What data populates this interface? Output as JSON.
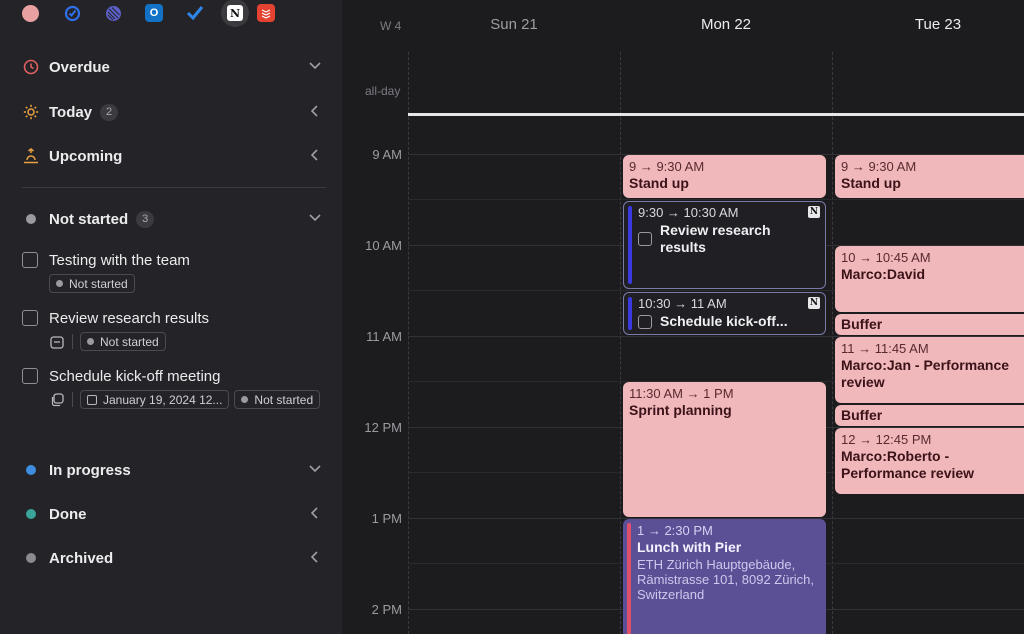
{
  "app_icons": [
    {
      "name": "avatar-icon",
      "color": "#e8a0a0"
    },
    {
      "name": "check-circle-icon",
      "color": "#2f6fed"
    },
    {
      "name": "linear-icon",
      "color": "#5b5fc7"
    },
    {
      "name": "outlook-icon",
      "color": "#1273c6"
    },
    {
      "name": "checkmark-icon",
      "color": "#2e86e8"
    },
    {
      "name": "notion-icon",
      "color": "#ffffff"
    },
    {
      "name": "todoist-icon",
      "color": "#e44332"
    }
  ],
  "sidebar": {
    "groups": [
      {
        "label": "Overdue",
        "count": "",
        "chevron": "⌄"
      },
      {
        "label": "Today",
        "count": "2",
        "chevron": "‹"
      },
      {
        "label": "Upcoming",
        "count": "",
        "chevron": "‹"
      },
      {
        "label": "Not started",
        "count": "3",
        "chevron": "⌄"
      },
      {
        "label": "In progress",
        "count": "",
        "chevron": "⌄"
      },
      {
        "label": "Done",
        "count": "",
        "chevron": "‹"
      },
      {
        "label": "Archived",
        "count": "",
        "chevron": "‹"
      }
    ],
    "status_colors": {
      "not_started": "#9a9aa0",
      "in_progress": "#3d8ee0",
      "done": "#3aa39a",
      "archived": "#8a8a90"
    },
    "tasks": [
      {
        "title": "Testing with the team",
        "status": "Not started"
      },
      {
        "title": "Review research results",
        "status": "Not started"
      },
      {
        "title": "Schedule kick-off meeting",
        "date": "January 19, 2024 12...",
        "status": "Not started"
      }
    ]
  },
  "calendar": {
    "week_label": "W 4",
    "days": [
      "Sun 21",
      "Mon 22",
      "Tue 23"
    ],
    "allday_label": "all-day",
    "hours": [
      "9 AM",
      "10 AM",
      "11 AM",
      "12 PM",
      "1 PM",
      "2 PM"
    ],
    "events": {
      "mon_standup": {
        "time": "9 → 9:30 AM",
        "title": "Stand up"
      },
      "mon_review": {
        "time": "9:30 → 10:30 AM",
        "title": "Review research results"
      },
      "mon_kickoff": {
        "time": "10:30 → 11 AM",
        "title": "Schedule kick-off..."
      },
      "mon_sprint": {
        "time": "11:30 AM → 1 PM",
        "title": "Sprint planning"
      },
      "mon_lunch": {
        "time": "1 → 2:30 PM",
        "title": "Lunch with Pier",
        "location": "ETH Zürich Hauptgebäude, Rämistrasse 101, 8092 Zürich, Switzerland"
      },
      "tue_standup": {
        "time": "9 → 9:30 AM",
        "title": "Stand up"
      },
      "tue_david": {
        "time": "10 → 10:45 AM",
        "title": "Marco:David"
      },
      "tue_buffer1": {
        "title": "Buffer"
      },
      "tue_jan": {
        "time": "11 → 11:45 AM",
        "title": "Marco:Jan - Performance review"
      },
      "tue_buffer2": {
        "title": "Buffer"
      },
      "tue_roberto": {
        "time": "12 → 12:45 PM",
        "title": "Marco:Roberto - Performance review"
      }
    }
  }
}
